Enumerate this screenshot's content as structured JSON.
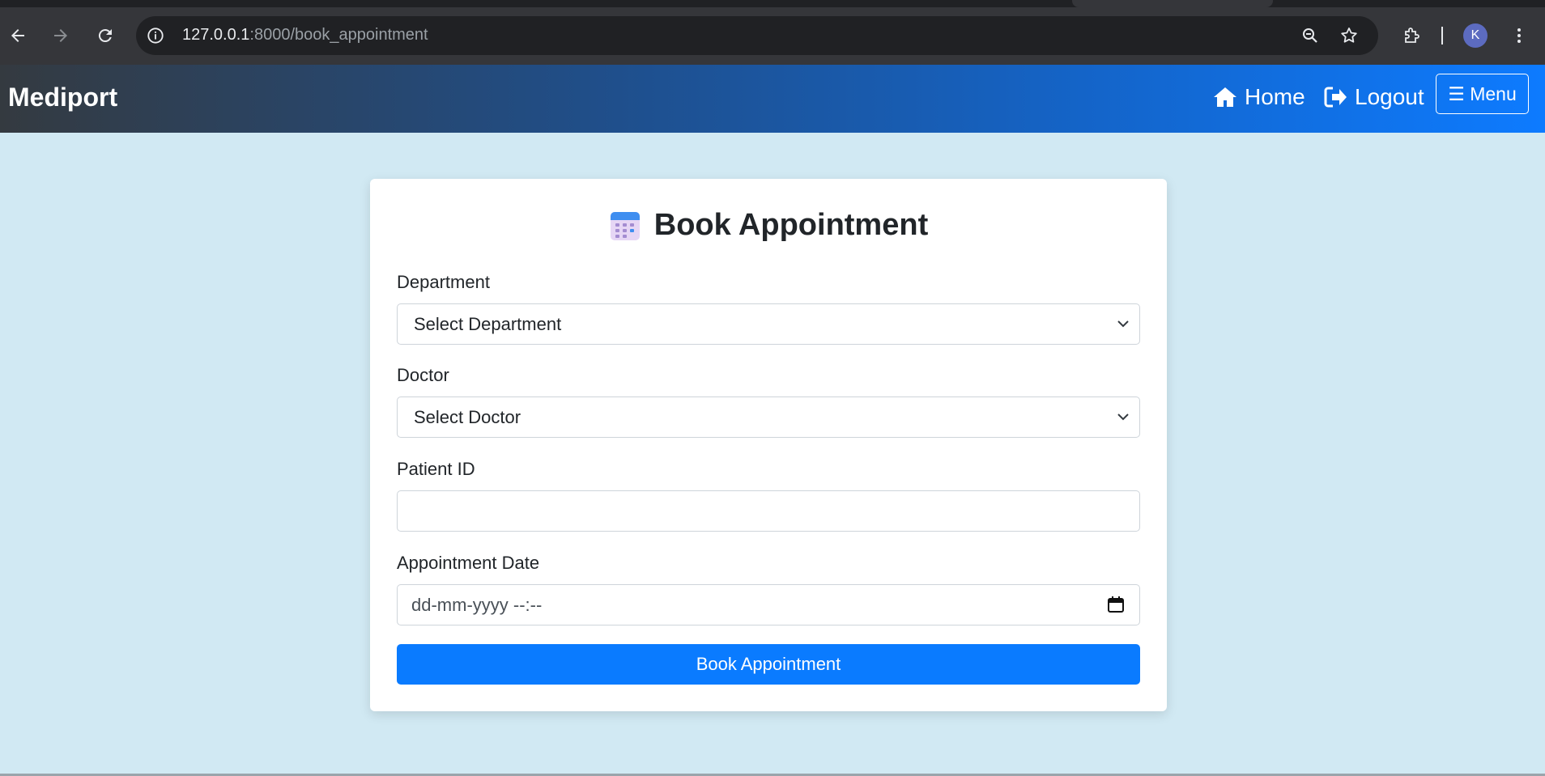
{
  "browser": {
    "url_host": "127.0.0.1",
    "url_rest": ":8000/book_appointment",
    "avatar_letter": "K"
  },
  "navbar": {
    "brand": "Mediport",
    "home_label": "Home",
    "logout_label": "Logout",
    "menu_label": "☰ Menu"
  },
  "form": {
    "title": "Book Appointment",
    "department_label": "Department",
    "department_selected": "Select Department",
    "doctor_label": "Doctor",
    "doctor_selected": "Select Doctor",
    "patient_id_label": "Patient ID",
    "patient_id_value": "",
    "date_label": "Appointment Date",
    "date_placeholder": "dd-mm-yyyy --:--",
    "submit_label": "Book Appointment"
  },
  "colors": {
    "page_bg": "#d1e9f3",
    "primary": "#0a7bff",
    "navbar_start": "#343a40",
    "navbar_end": "#0d7bff"
  }
}
